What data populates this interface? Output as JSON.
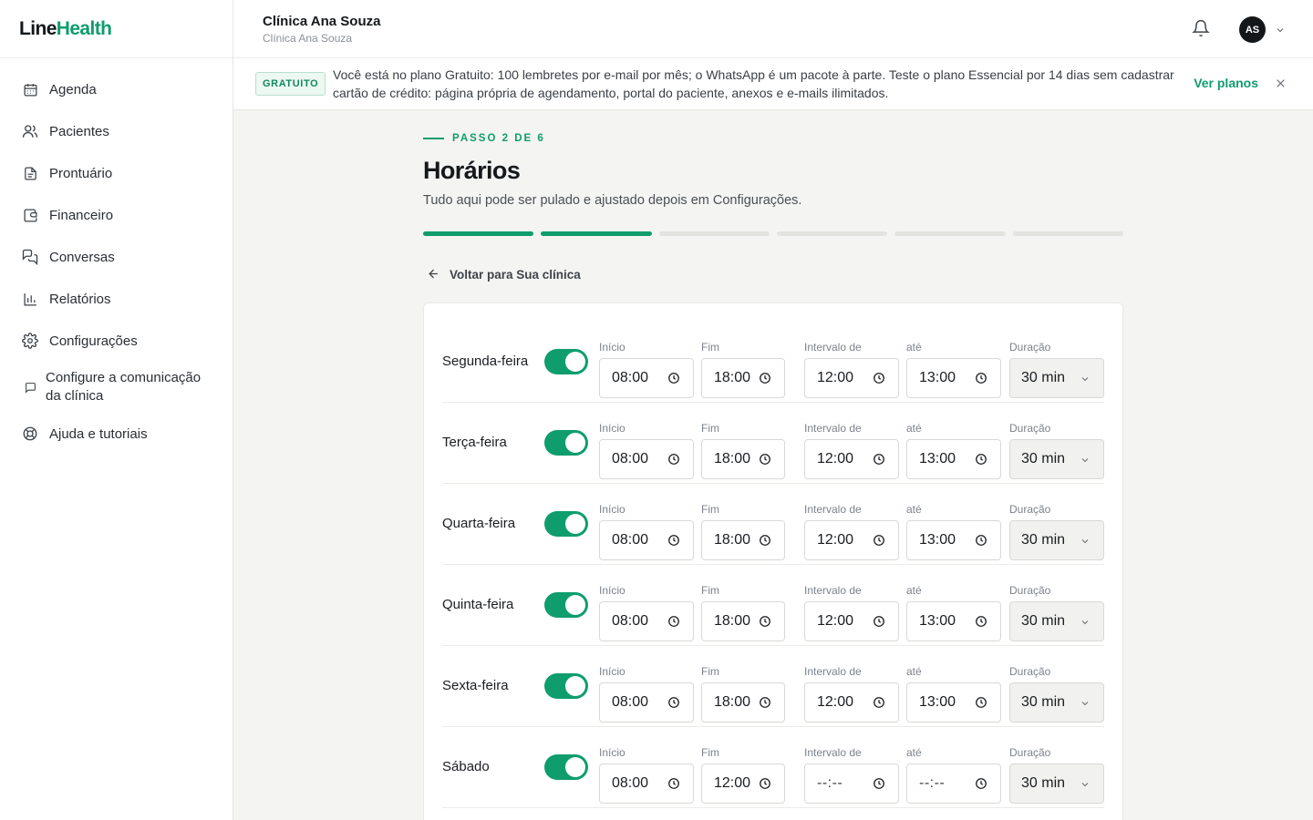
{
  "brand": {
    "part1": "Line",
    "part2": "Health",
    "accent": "#0f9d6d"
  },
  "sidebar": {
    "items": [
      {
        "label": "Agenda",
        "icon": "calendar-icon"
      },
      {
        "label": "Pacientes",
        "icon": "users-icon"
      },
      {
        "label": "Prontuário",
        "icon": "file-text-icon"
      },
      {
        "label": "Financeiro",
        "icon": "wallet-icon"
      },
      {
        "label": "Conversas",
        "icon": "chat-bubbles-icon"
      },
      {
        "label": "Relatórios",
        "icon": "bar-chart-icon"
      },
      {
        "label": "Configurações",
        "icon": "gear-icon"
      },
      {
        "label": "Configure a comunicação da clínica",
        "icon": "message-square-icon"
      },
      {
        "label": "Ajuda e tutoriais",
        "icon": "lifebuoy-icon"
      }
    ]
  },
  "header": {
    "clinic_name": "Clínica Ana Souza",
    "clinic_sub": "Clínica Ana Souza",
    "avatar_initials": "AS"
  },
  "banner": {
    "badge": "GRATUITO",
    "text": "Você está no plano Gratuito: 100 lembretes por e-mail por mês; o WhatsApp é um pacote à parte. Teste o plano Essencial por 14 dias sem cadastrar cartão de crédito: página própria de agendamento, portal do paciente, anexos e e-mails ilimitados.",
    "link": "Ver planos"
  },
  "wizard": {
    "step_label": "PASSO 2 DE 6",
    "title": "Horários",
    "subtitle": "Tudo aqui pode ser pulado e ajustado depois em Configurações.",
    "steps_total": 6,
    "steps_done": 2,
    "back_label": "Voltar para Sua clínica"
  },
  "schedule": {
    "labels": {
      "start": "Início",
      "end": "Fim",
      "break_from": "Intervalo de",
      "break_to": "até",
      "duration": "Duração"
    },
    "days": [
      {
        "name": "Segunda-feira",
        "enabled": true,
        "start": "08:00",
        "end": "18:00",
        "break_from": "12:00",
        "break_to": "13:00",
        "duration": "30 min"
      },
      {
        "name": "Terça-feira",
        "enabled": true,
        "start": "08:00",
        "end": "18:00",
        "break_from": "12:00",
        "break_to": "13:00",
        "duration": "30 min"
      },
      {
        "name": "Quarta-feira",
        "enabled": true,
        "start": "08:00",
        "end": "18:00",
        "break_from": "12:00",
        "break_to": "13:00",
        "duration": "30 min"
      },
      {
        "name": "Quinta-feira",
        "enabled": true,
        "start": "08:00",
        "end": "18:00",
        "break_from": "12:00",
        "break_to": "13:00",
        "duration": "30 min"
      },
      {
        "name": "Sexta-feira",
        "enabled": true,
        "start": "08:00",
        "end": "18:00",
        "break_from": "12:00",
        "break_to": "13:00",
        "duration": "30 min"
      },
      {
        "name": "Sábado",
        "enabled": true,
        "start": "08:00",
        "end": "12:00",
        "break_from": "--:--",
        "break_to": "--:--",
        "duration": "30 min"
      }
    ]
  }
}
